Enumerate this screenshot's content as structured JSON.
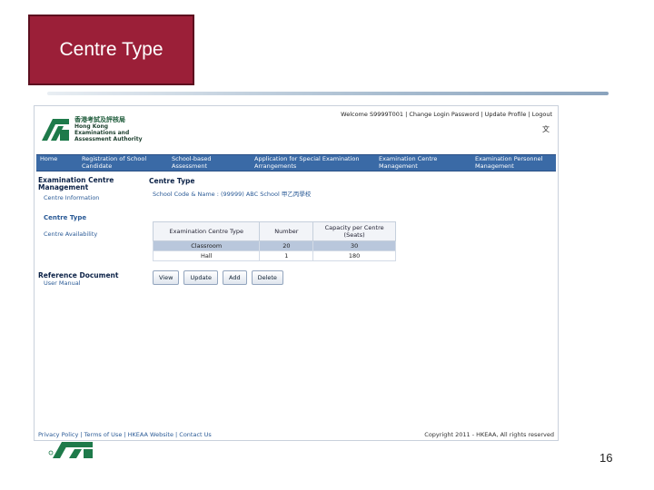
{
  "slide": {
    "title": "Centre Type",
    "page_number": "16",
    "colors": {
      "title_bg": "#9b1f38",
      "nav_bg": "#3a6aa6",
      "accent": "#2a5a96"
    }
  },
  "app": {
    "logo": {
      "chinese": "香港考試及評核局",
      "english_lines": [
        "Hong Kong",
        "Examinations and",
        "Assessment Authority"
      ]
    },
    "top_links": [
      "Welcome S9999T001",
      "Change Login Password",
      "Update Profile",
      "Logout"
    ],
    "lang_toggle": "文",
    "nav": [
      "Home",
      "Registration of School Candidate",
      "School-based Assessment",
      "Application for Special Examination Arrangements",
      "Examination Centre Management",
      "Examination Personnel Management"
    ],
    "sidebar": {
      "section1": "Examination Centre Management",
      "links": [
        "Centre Information",
        "Centre Type",
        "Centre Availability"
      ],
      "section2": "Reference Document",
      "ref_links": [
        "User Manual"
      ]
    },
    "content": {
      "title": "Centre Type",
      "school_label": "School Code & Name :",
      "school_code": "(99999)",
      "school_name": "ABC School",
      "school_name_zh": "甲乙丙學校"
    },
    "table": {
      "headers": [
        "Examination Centre Type",
        "Number",
        "Capacity per Centre (Seats)"
      ],
      "rows": [
        {
          "type": "Classroom",
          "number": "20",
          "capacity": "30"
        },
        {
          "type": "Hall",
          "number": "1",
          "capacity": "180"
        }
      ]
    },
    "buttons": [
      "View",
      "Update",
      "Add",
      "Delete"
    ],
    "footer": {
      "links": [
        "Privacy Policy",
        "Terms of Use",
        "HKEAA Website",
        "Contact Us"
      ],
      "copyright": "Copyright 2011 - HKEAA, All rights reserved"
    }
  }
}
